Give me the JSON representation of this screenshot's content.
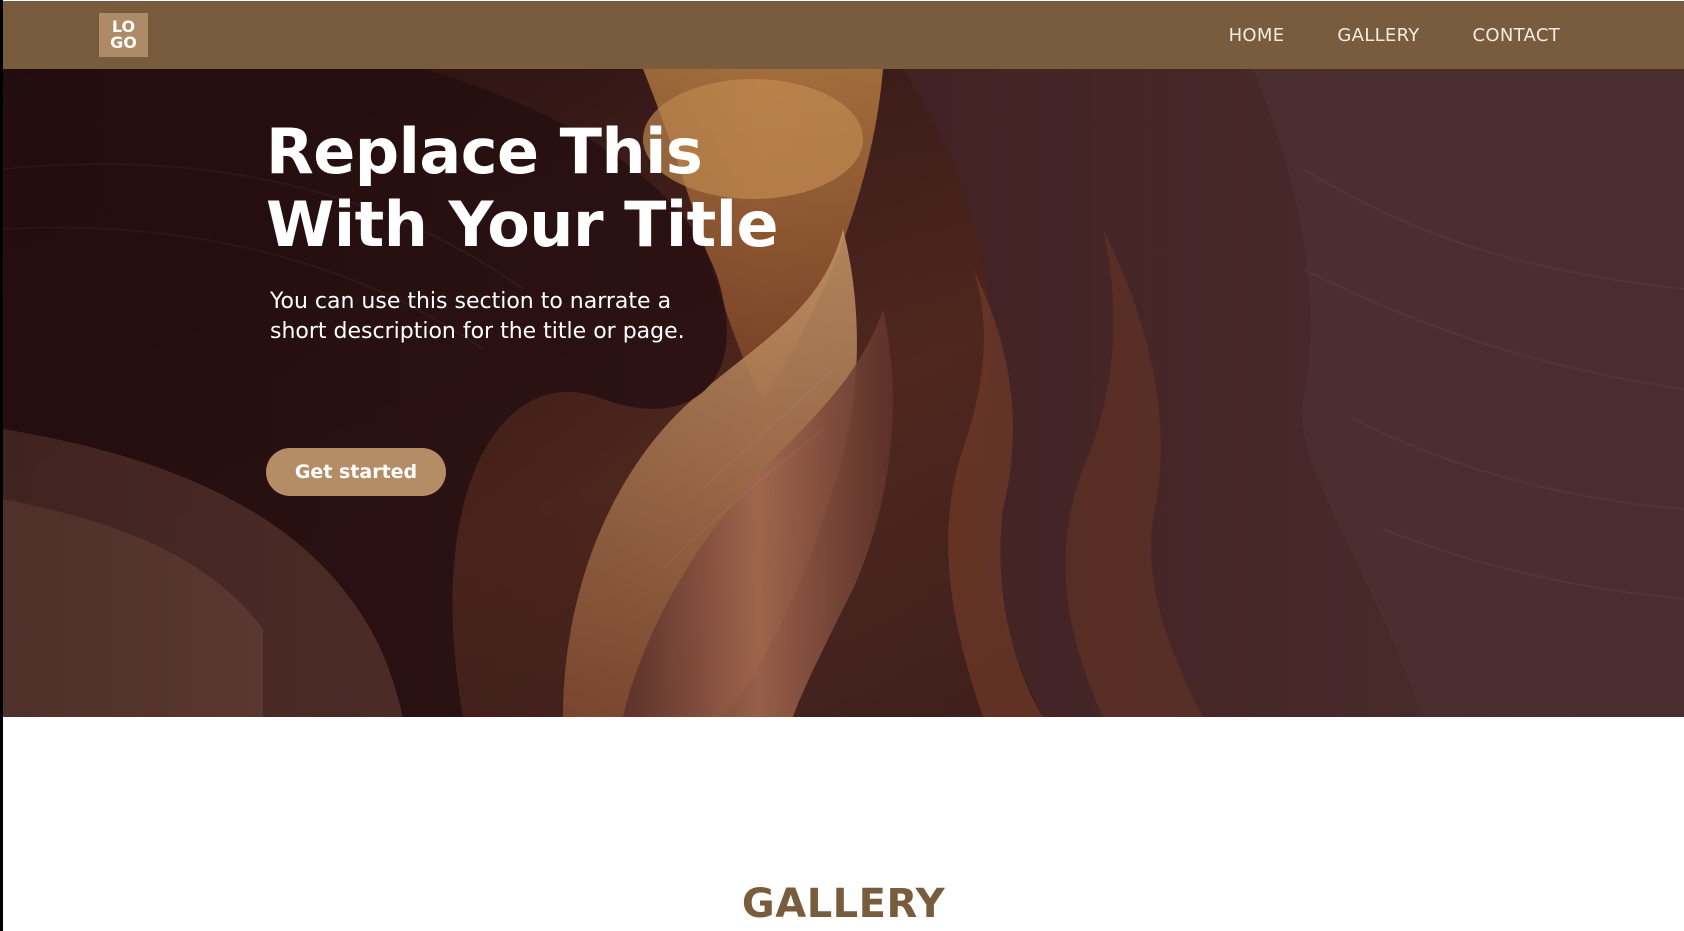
{
  "header": {
    "logo_line1": "LO",
    "logo_line2": "GO",
    "nav": [
      {
        "label": "HOME"
      },
      {
        "label": "GALLERY"
      },
      {
        "label": "CONTACT"
      }
    ]
  },
  "hero": {
    "title_line1": "Replace This",
    "title_line2": "With Your Title",
    "description": "You can use this section to narrate a short description for the title or page.",
    "button_label": "Get started"
  },
  "gallery": {
    "heading": "GALLERY"
  },
  "colors": {
    "header_bg": "#785c3d",
    "logo_bg": "#ae8b67",
    "button_bg": "#b48d66",
    "heading_text": "#785c3d",
    "hero_dark": "#3a1f1c"
  }
}
